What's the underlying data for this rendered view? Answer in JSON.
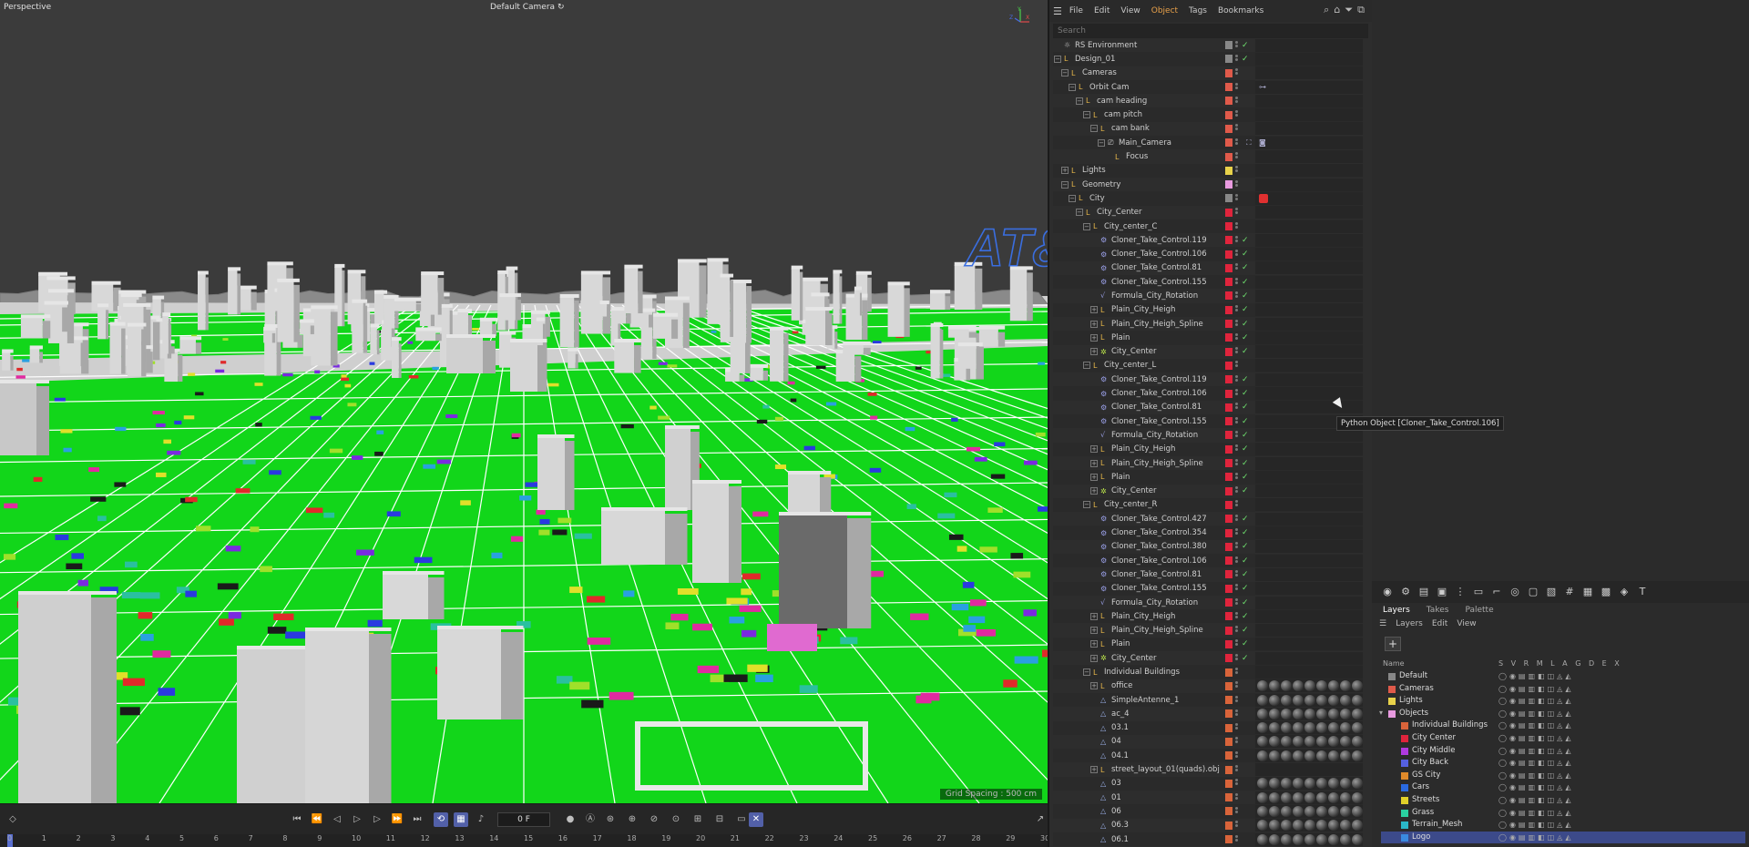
{
  "viewport": {
    "title": "Perspective",
    "camera": "Default Camera",
    "camera_suffix": "↻",
    "grid_spacing": "Grid Spacing : 500 cm",
    "logo_text": "AT&",
    "axis": {
      "y": "Y",
      "x": "X",
      "z": "Z"
    }
  },
  "transport": {
    "frame": "0 F",
    "ruler_ticks": [
      "0",
      "1",
      "2",
      "3",
      "4",
      "5",
      "6",
      "7",
      "8",
      "9",
      "10",
      "11",
      "12",
      "13",
      "14",
      "15",
      "16",
      "17",
      "18",
      "19",
      "20",
      "21",
      "22",
      "23",
      "24",
      "25",
      "26",
      "27",
      "28",
      "29",
      "30"
    ]
  },
  "object_manager": {
    "menu": [
      "File",
      "Edit",
      "View",
      "Object",
      "Tags",
      "Bookmarks"
    ],
    "active_menu": "Object",
    "search_placeholder": "Search",
    "rows": [
      {
        "name": "RS Environment",
        "indent": 0,
        "icon": "env",
        "color": "#888888",
        "check": true,
        "expand": ""
      },
      {
        "name": "Design_01",
        "indent": 0,
        "icon": "null",
        "color": "#888888",
        "check": true,
        "expand": "−"
      },
      {
        "name": "Cameras",
        "indent": 1,
        "icon": "null",
        "color": "#e05a4a",
        "check": false,
        "expand": "−"
      },
      {
        "name": "Orbit Cam",
        "indent": 2,
        "icon": "null",
        "color": "#e05a4a",
        "check": false,
        "expand": "−",
        "tag": "link"
      },
      {
        "name": "cam heading",
        "indent": 3,
        "icon": "null",
        "color": "#e05a4a",
        "check": false,
        "expand": "−"
      },
      {
        "name": "cam pitch",
        "indent": 4,
        "icon": "null",
        "color": "#e05a4a",
        "check": false,
        "expand": "−"
      },
      {
        "name": "cam bank",
        "indent": 5,
        "icon": "null",
        "color": "#e05a4a",
        "check": false,
        "expand": "−"
      },
      {
        "name": "Main_Camera",
        "indent": 6,
        "icon": "camera",
        "color": "#e05a4a",
        "check": false,
        "expand": "−",
        "tag": "camera"
      },
      {
        "name": "Focus",
        "indent": 7,
        "icon": "null",
        "color": "#e05a4a",
        "check": false,
        "expand": ""
      },
      {
        "name": "Lights",
        "indent": 1,
        "icon": "null",
        "color": "#e8d24a",
        "check": false,
        "expand": "+"
      },
      {
        "name": "Geometry",
        "indent": 1,
        "icon": "null",
        "color": "#e89adf",
        "check": false,
        "expand": "−"
      },
      {
        "name": "City",
        "indent": 2,
        "icon": "null",
        "color": "#888888",
        "check": false,
        "expand": "−",
        "tag": "cube"
      },
      {
        "name": "City_Center",
        "indent": 3,
        "icon": "null",
        "color": "#e0243c",
        "check": false,
        "expand": "−"
      },
      {
        "name": "City_center_C",
        "indent": 4,
        "icon": "null",
        "color": "#e0243c",
        "check": false,
        "expand": "−"
      },
      {
        "name": "Cloner_Take_Control.119",
        "indent": 5,
        "icon": "gear",
        "color": "#e0243c",
        "check": true,
        "expand": ""
      },
      {
        "name": "Cloner_Take_Control.106",
        "indent": 5,
        "icon": "gear",
        "color": "#e0243c",
        "check": true,
        "expand": ""
      },
      {
        "name": "Cloner_Take_Control.81",
        "indent": 5,
        "icon": "gear",
        "color": "#e0243c",
        "check": true,
        "expand": ""
      },
      {
        "name": "Cloner_Take_Control.155",
        "indent": 5,
        "icon": "gear",
        "color": "#e0243c",
        "check": true,
        "expand": ""
      },
      {
        "name": "Formula_City_Rotation",
        "indent": 5,
        "icon": "formula",
        "color": "#e0243c",
        "check": true,
        "expand": ""
      },
      {
        "name": "Plain_City_Heigh",
        "indent": 5,
        "icon": "null",
        "color": "#e0243c",
        "check": true,
        "expand": "+"
      },
      {
        "name": "Plain_City_Heigh_Spline",
        "indent": 5,
        "icon": "null",
        "color": "#e0243c",
        "check": true,
        "expand": "+"
      },
      {
        "name": "Plain",
        "indent": 5,
        "icon": "null",
        "color": "#e0243c",
        "check": true,
        "expand": "+"
      },
      {
        "name": "City_Center",
        "indent": 5,
        "icon": "cloner",
        "color": "#e0243c",
        "check": true,
        "expand": "+"
      },
      {
        "name": "City_center_L",
        "indent": 4,
        "icon": "null",
        "color": "#e0243c",
        "check": false,
        "expand": "−"
      },
      {
        "name": "Cloner_Take_Control.119",
        "indent": 5,
        "icon": "gear",
        "color": "#e0243c",
        "check": true,
        "expand": ""
      },
      {
        "name": "Cloner_Take_Control.106",
        "indent": 5,
        "icon": "gear",
        "color": "#e0243c",
        "check": true,
        "expand": ""
      },
      {
        "name": "Cloner_Take_Control.81",
        "indent": 5,
        "icon": "gear",
        "color": "#e0243c",
        "check": true,
        "expand": ""
      },
      {
        "name": "Cloner_Take_Control.155",
        "indent": 5,
        "icon": "gear",
        "color": "#e0243c",
        "check": true,
        "expand": ""
      },
      {
        "name": "Formula_City_Rotation",
        "indent": 5,
        "icon": "formula",
        "color": "#e0243c",
        "check": true,
        "expand": ""
      },
      {
        "name": "Plain_City_Heigh",
        "indent": 5,
        "icon": "null",
        "color": "#e0243c",
        "check": true,
        "expand": "+"
      },
      {
        "name": "Plain_City_Heigh_Spline",
        "indent": 5,
        "icon": "null",
        "color": "#e0243c",
        "check": true,
        "expand": "+"
      },
      {
        "name": "Plain",
        "indent": 5,
        "icon": "null",
        "color": "#e0243c",
        "check": true,
        "expand": "+"
      },
      {
        "name": "City_Center",
        "indent": 5,
        "icon": "cloner",
        "color": "#e0243c",
        "check": true,
        "expand": "+"
      },
      {
        "name": "City_center_R",
        "indent": 4,
        "icon": "null",
        "color": "#e0243c",
        "check": false,
        "expand": "−"
      },
      {
        "name": "Cloner_Take_Control.427",
        "indent": 5,
        "icon": "gear",
        "color": "#e0243c",
        "check": true,
        "expand": ""
      },
      {
        "name": "Cloner_Take_Control.354",
        "indent": 5,
        "icon": "gear",
        "color": "#e0243c",
        "check": true,
        "expand": ""
      },
      {
        "name": "Cloner_Take_Control.380",
        "indent": 5,
        "icon": "gear",
        "color": "#e0243c",
        "check": true,
        "expand": ""
      },
      {
        "name": "Cloner_Take_Control.106",
        "indent": 5,
        "icon": "gear",
        "color": "#e0243c",
        "check": true,
        "expand": ""
      },
      {
        "name": "Cloner_Take_Control.81",
        "indent": 5,
        "icon": "gear",
        "color": "#e0243c",
        "check": true,
        "expand": ""
      },
      {
        "name": "Cloner_Take_Control.155",
        "indent": 5,
        "icon": "gear",
        "color": "#e0243c",
        "check": true,
        "expand": ""
      },
      {
        "name": "Formula_City_Rotation",
        "indent": 5,
        "icon": "formula",
        "color": "#e0243c",
        "check": true,
        "expand": ""
      },
      {
        "name": "Plain_City_Heigh",
        "indent": 5,
        "icon": "null",
        "color": "#e0243c",
        "check": true,
        "expand": "+"
      },
      {
        "name": "Plain_City_Heigh_Spline",
        "indent": 5,
        "icon": "null",
        "color": "#e0243c",
        "check": true,
        "expand": "+"
      },
      {
        "name": "Plain",
        "indent": 5,
        "icon": "null",
        "color": "#e0243c",
        "check": true,
        "expand": "+"
      },
      {
        "name": "City_Center",
        "indent": 5,
        "icon": "cloner",
        "color": "#e0243c",
        "check": true,
        "expand": "+"
      },
      {
        "name": "Individual Buildings",
        "indent": 4,
        "icon": "null",
        "color": "#d9643a",
        "check": false,
        "expand": "−"
      },
      {
        "name": "office",
        "indent": 5,
        "icon": "null",
        "color": "#d9643a",
        "check": false,
        "expand": "+",
        "mats": 9
      },
      {
        "name": "SimpleAntenne_1",
        "indent": 5,
        "icon": "poly",
        "color": "#d9643a",
        "check": false,
        "expand": "",
        "mats": 9
      },
      {
        "name": "ac_4",
        "indent": 5,
        "icon": "poly",
        "color": "#d9643a",
        "check": false,
        "expand": "",
        "mats": 9
      },
      {
        "name": "03.1",
        "indent": 5,
        "icon": "poly",
        "color": "#d9643a",
        "check": false,
        "expand": "",
        "mats": 9
      },
      {
        "name": "04",
        "indent": 5,
        "icon": "poly",
        "color": "#d9643a",
        "check": false,
        "expand": "",
        "mats": 9
      },
      {
        "name": "04.1",
        "indent": 5,
        "icon": "poly",
        "color": "#d9643a",
        "check": false,
        "expand": "",
        "mats": 9
      },
      {
        "name": "street_layout_01(quads).obj",
        "indent": 5,
        "icon": "null",
        "color": "#d9643a",
        "check": false,
        "expand": "+"
      },
      {
        "name": "03",
        "indent": 5,
        "icon": "poly",
        "color": "#d9643a",
        "check": false,
        "expand": "",
        "mats": 9
      },
      {
        "name": "01",
        "indent": 5,
        "icon": "poly",
        "color": "#d9643a",
        "check": false,
        "expand": "",
        "mats": 9
      },
      {
        "name": "06",
        "indent": 5,
        "icon": "poly",
        "color": "#d9643a",
        "check": false,
        "expand": "",
        "mats": 9
      },
      {
        "name": "06.3",
        "indent": 5,
        "icon": "poly",
        "color": "#d9643a",
        "check": false,
        "expand": "",
        "mats": 9
      },
      {
        "name": "06.1",
        "indent": 5,
        "icon": "poly",
        "color": "#d9643a",
        "check": false,
        "expand": "",
        "mats": 9
      }
    ]
  },
  "tooltip": "Python Object [Cloner_Take_Control.106]",
  "layers": {
    "tabs": [
      "Layers",
      "Takes",
      "Palette"
    ],
    "menu": [
      "Layers",
      "Edit",
      "View"
    ],
    "add_label": "+",
    "columns": {
      "name": "Name",
      "flags": "S V R M L A G D E X"
    },
    "flags_glyphs": "◯◉▤▥◧◫◬◭",
    "items": [
      {
        "name": "Default",
        "color": "#888888",
        "indent": 0,
        "selected": false
      },
      {
        "name": "Cameras",
        "color": "#e05a4a",
        "indent": 0,
        "selected": false
      },
      {
        "name": "Lights",
        "color": "#e8d24a",
        "indent": 0,
        "selected": false
      },
      {
        "name": "Objects",
        "color": "#e89adf",
        "indent": 0,
        "selected": false
      },
      {
        "name": "Individual Buildings",
        "color": "#d9643a",
        "indent": 1,
        "selected": false
      },
      {
        "name": "City Center",
        "color": "#e0243c",
        "indent": 1,
        "selected": false
      },
      {
        "name": "City Middle",
        "color": "#b03ae0",
        "indent": 1,
        "selected": false
      },
      {
        "name": "City Back",
        "color": "#5560e0",
        "indent": 1,
        "selected": false
      },
      {
        "name": "GS City",
        "color": "#e08a2a",
        "indent": 1,
        "selected": false
      },
      {
        "name": "Cars",
        "color": "#2a6ae0",
        "indent": 1,
        "selected": false
      },
      {
        "name": "Streets",
        "color": "#e0d02a",
        "indent": 1,
        "selected": false
      },
      {
        "name": "Grass",
        "color": "#2ad0a0",
        "indent": 1,
        "selected": false
      },
      {
        "name": "Terrain_Mesh",
        "color": "#2ab8c8",
        "indent": 1,
        "selected": false
      },
      {
        "name": "Logo",
        "color": "#3a8ae0",
        "indent": 1,
        "selected": true
      }
    ]
  }
}
